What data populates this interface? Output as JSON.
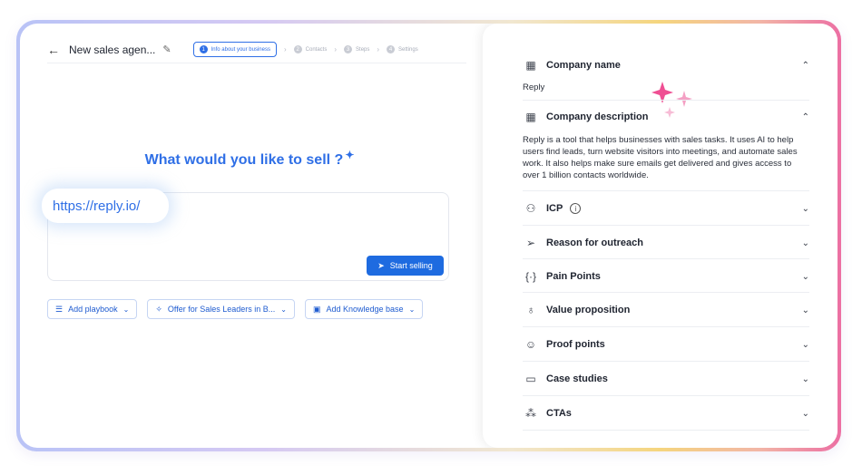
{
  "editor": {
    "title": "New sales agen...",
    "steps": [
      {
        "num": "1",
        "label": "Info about your business"
      },
      {
        "num": "2",
        "label": "Contacts"
      },
      {
        "num": "3",
        "label": "Steps"
      },
      {
        "num": "4",
        "label": "Settings"
      }
    ],
    "heading": "What would you like to sell ?",
    "url_value": "https://reply.io/",
    "start_label": "Start selling",
    "chips": [
      {
        "label": "Add playbook"
      },
      {
        "label": "Offer for Sales Leaders in B..."
      },
      {
        "label": "Add Knowledge base"
      }
    ]
  },
  "panel": {
    "company_name": {
      "title": "Company name",
      "value": "Reply"
    },
    "company_description": {
      "title": "Company description",
      "value": "Reply is a tool that helps businesses with sales tasks. It uses AI to help users find leads, turn website visitors into meetings, and automate sales work. It also helps make sure emails get delivered and gives access to over 1 billion contacts worldwide."
    },
    "sections": [
      {
        "title": "ICP"
      },
      {
        "title": "Reason for outreach"
      },
      {
        "title": "Pain Points"
      },
      {
        "title": "Value proposition"
      },
      {
        "title": "Proof points"
      },
      {
        "title": "Case studies"
      },
      {
        "title": "CTAs"
      }
    ]
  },
  "colors": {
    "accent": "#2f6fe6",
    "button": "#1e6be0",
    "sparkle": "#ef5d9a"
  }
}
